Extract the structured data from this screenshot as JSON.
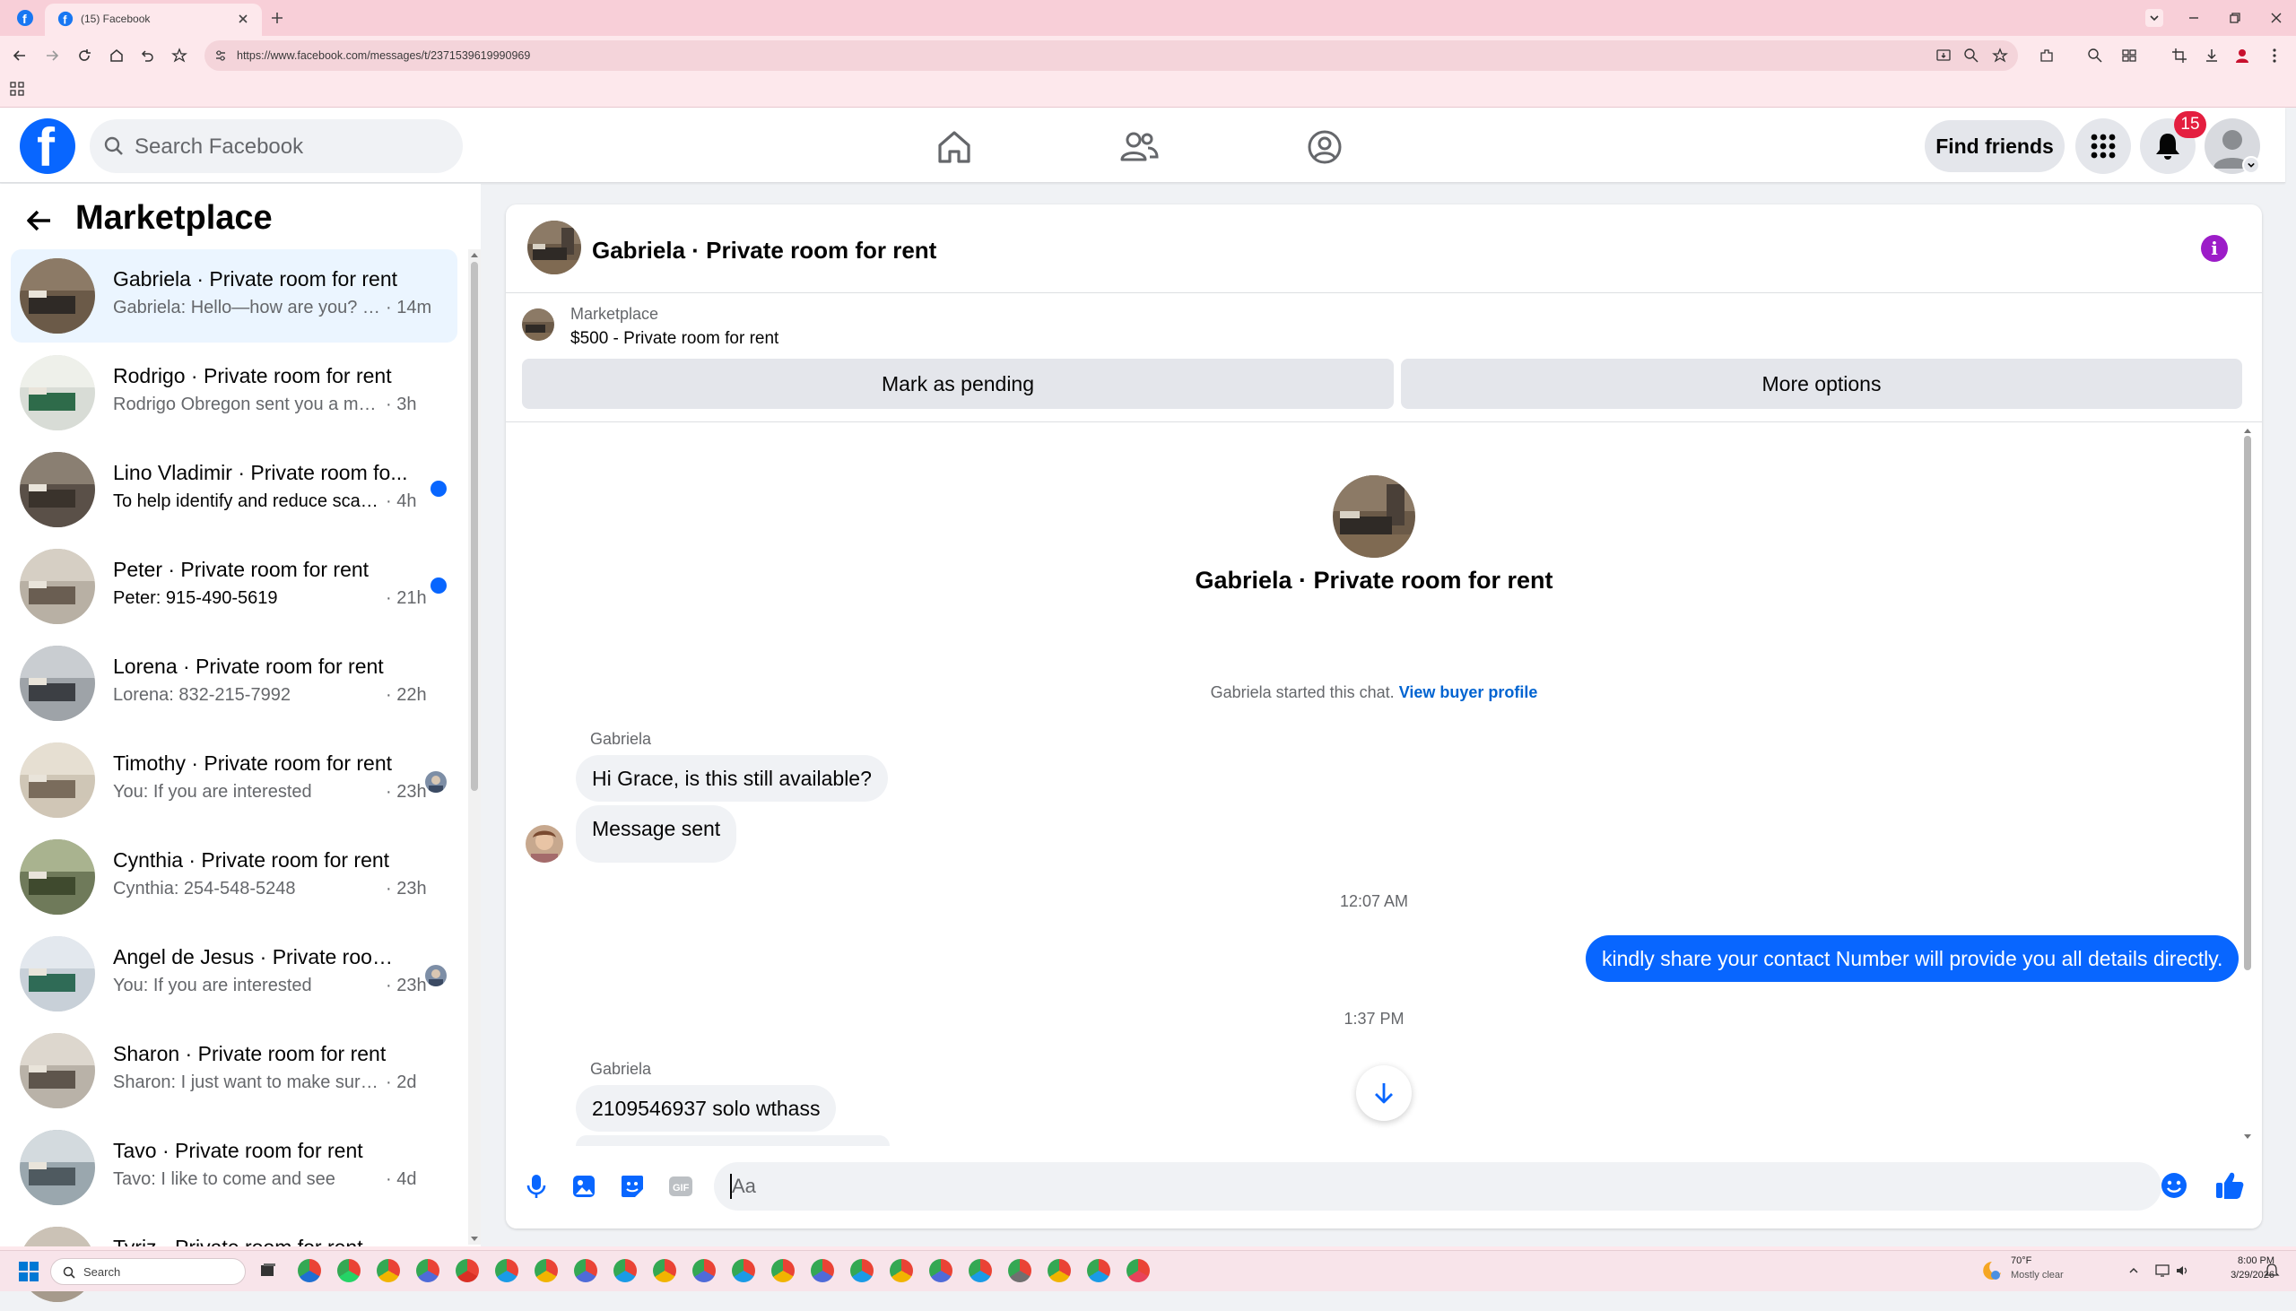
{
  "browser": {
    "tab_title": "(15) Facebook",
    "url": "https://www.facebook.com/messages/t/2371539619990969"
  },
  "header": {
    "search_placeholder": "Search Facebook",
    "find_friends": "Find friends",
    "notification_count": "15",
    "brand_color": "#0866ff"
  },
  "sidebar": {
    "title": "Marketplace",
    "conversations": [
      {
        "name": "Gabriela · Private room for rent",
        "preview": "Gabriela: Hello—how are you? Co...",
        "time": "· 14m",
        "selected": true,
        "unread": false
      },
      {
        "name": "Rodrigo · Private room for rent",
        "preview": "Rodrigo Obregon sent you a messa...",
        "time": "· 3h",
        "unread": false
      },
      {
        "name": "Lino Vladimir · Private room fo...",
        "preview": "To help identify and reduce scam...",
        "time": "· 4h",
        "unread": true
      },
      {
        "name": "Peter · Private room for rent",
        "preview": "Peter: 915-490-5619",
        "time": "· 21h",
        "unread": true
      },
      {
        "name": "Lorena · Private room for rent",
        "preview": "Lorena: 832-215-7992",
        "time": "· 22h",
        "unread": false
      },
      {
        "name": "Timothy · Private room for rent",
        "preview": "You: If you are interested",
        "time": "· 23h",
        "unread": false,
        "read_receipt": true
      },
      {
        "name": "Cynthia · Private room for rent",
        "preview": "Cynthia: 254-548-5248",
        "time": "· 23h",
        "unread": false
      },
      {
        "name": "Angel de Jesus · Private room ...",
        "preview": "You: If you are interested",
        "time": "· 23h",
        "unread": false,
        "read_receipt": true
      },
      {
        "name": "Sharon · Private room for rent",
        "preview": "Sharon: I just want to make sure wh...",
        "time": "· 2d",
        "unread": false
      },
      {
        "name": "Tavo · Private room for rent",
        "preview": "Tavo: I like to come and see",
        "time": "· 4d",
        "unread": false
      },
      {
        "name": "Tyriz · Private room for rent",
        "preview": "",
        "time": "",
        "unread": false
      }
    ]
  },
  "chat": {
    "title": "Gabriela · Private room for rent",
    "marketplace_label": "Marketplace",
    "listing": "$500 - Private room for rent",
    "mark_pending": "Mark as pending",
    "more_options": "More options",
    "big_title": "Gabriela · Private room for rent",
    "started_text": "Gabriela started this chat.",
    "view_buyer_profile": "View buyer profile",
    "messages": {
      "sender1": "Gabriela",
      "in1": "Hi Grace, is this still available?",
      "in2": "Message sent",
      "time1": "12:07 AM",
      "out1": "kindly share your contact Number will provide you all details directly.",
      "time2": "1:37 PM",
      "sender2": "Gabriela",
      "in3": "2109546937 solo wthass"
    },
    "composer_placeholder": "Aa"
  },
  "taskbar": {
    "search_placeholder": "Search",
    "weather_temp": "70°F",
    "weather_desc": "Mostly clear",
    "time": "8:00 PM",
    "date": "3/29/2026"
  }
}
